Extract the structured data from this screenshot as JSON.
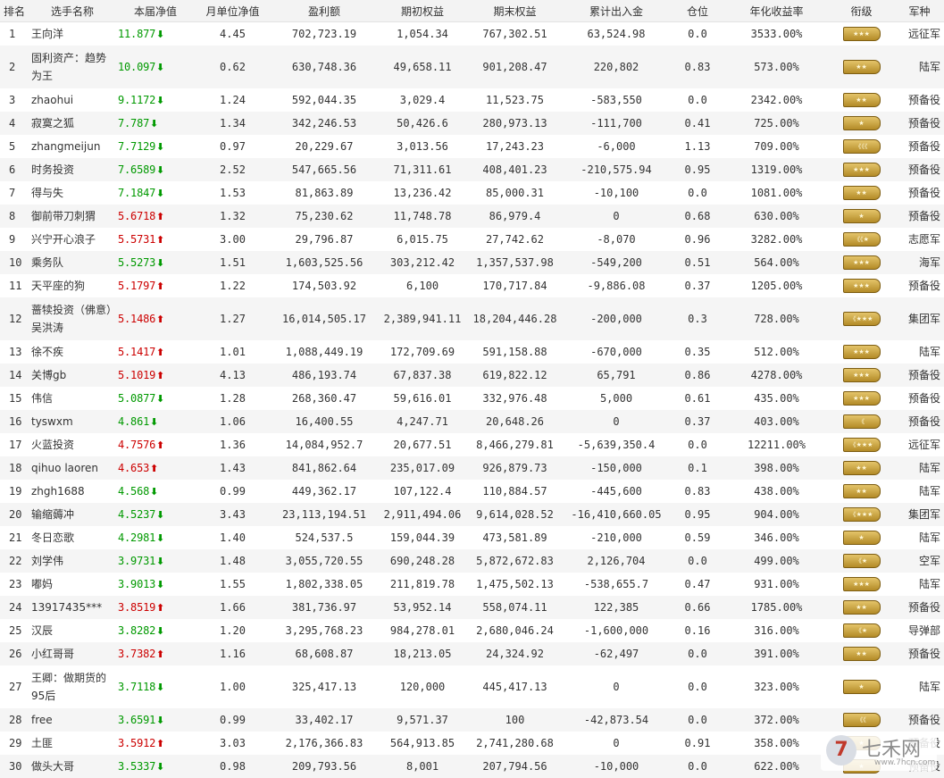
{
  "table": {
    "headers": [
      "排名",
      "选手名称",
      "本届净值",
      "月单位净值",
      "盈利额",
      "期初权益",
      "期末权益",
      "累计出入金",
      "仓位",
      "年化收益率",
      "衔级",
      "军种"
    ],
    "rows": [
      {
        "rank": "1",
        "name": "王向洋",
        "nav": "11.877",
        "trend": "down",
        "unit": "4.45",
        "profit": "702,723.19",
        "start": "1,054.34",
        "end": "767,302.51",
        "flow": "63,524.98",
        "position": "0.0",
        "annual": "3533.00%",
        "rank_badge": "★★★",
        "arm": "远征军"
      },
      {
        "rank": "2",
        "name": "固利资产：趋势为王",
        "nav": "10.097",
        "trend": "down",
        "unit": "0.62",
        "profit": "630,748.36",
        "start": "49,658.11",
        "end": "901,208.47",
        "flow": "220,802",
        "position": "0.83",
        "annual": "573.00%",
        "rank_badge": "★★",
        "arm": "陆军"
      },
      {
        "rank": "3",
        "name": "zhaohui",
        "nav": "9.1172",
        "trend": "down",
        "unit": "1.24",
        "profit": "592,044.35",
        "start": "3,029.4",
        "end": "11,523.75",
        "flow": "-583,550",
        "position": "0.0",
        "annual": "2342.00%",
        "rank_badge": "★★",
        "arm": "预备役"
      },
      {
        "rank": "4",
        "name": "寂寞之狐",
        "nav": "7.787",
        "trend": "down",
        "unit": "1.34",
        "profit": "342,246.53",
        "start": "50,426.6",
        "end": "280,973.13",
        "flow": "-111,700",
        "position": "0.41",
        "annual": "725.00%",
        "rank_badge": "★",
        "arm": "预备役"
      },
      {
        "rank": "5",
        "name": "zhangmeijun",
        "nav": "7.7129",
        "trend": "down",
        "unit": "0.97",
        "profit": "20,229.67",
        "start": "3,013.56",
        "end": "17,243.23",
        "flow": "-6,000",
        "position": "1.13",
        "annual": "709.00%",
        "rank_badge": "《《《",
        "arm": "预备役"
      },
      {
        "rank": "6",
        "name": "时务投资",
        "nav": "7.6589",
        "trend": "down",
        "unit": "2.52",
        "profit": "547,665.56",
        "start": "71,311.61",
        "end": "408,401.23",
        "flow": "-210,575.94",
        "position": "0.95",
        "annual": "1319.00%",
        "rank_badge": "★★★",
        "arm": "预备役"
      },
      {
        "rank": "7",
        "name": "得与失",
        "nav": "7.1847",
        "trend": "down",
        "unit": "1.53",
        "profit": "81,863.89",
        "start": "13,236.42",
        "end": "85,000.31",
        "flow": "-10,100",
        "position": "0.0",
        "annual": "1081.00%",
        "rank_badge": "★★",
        "arm": "预备役"
      },
      {
        "rank": "8",
        "name": "御前带刀刺猬",
        "nav": "5.6718",
        "trend": "up",
        "unit": "1.32",
        "profit": "75,230.62",
        "start": "11,748.78",
        "end": "86,979.4",
        "flow": "0",
        "position": "0.68",
        "annual": "630.00%",
        "rank_badge": "★",
        "arm": "预备役"
      },
      {
        "rank": "9",
        "name": "兴宁开心浪子",
        "nav": "5.5731",
        "trend": "up",
        "unit": "3.00",
        "profit": "29,796.87",
        "start": "6,015.75",
        "end": "27,742.62",
        "flow": "-8,070",
        "position": "0.96",
        "annual": "3282.00%",
        "rank_badge": "《《★",
        "arm": "志愿军"
      },
      {
        "rank": "10",
        "name": "乘务队",
        "nav": "5.5273",
        "trend": "down",
        "unit": "1.51",
        "profit": "1,603,525.56",
        "start": "303,212.42",
        "end": "1,357,537.98",
        "flow": "-549,200",
        "position": "0.51",
        "annual": "564.00%",
        "rank_badge": "★★★",
        "arm": "海军"
      },
      {
        "rank": "11",
        "name": "天平座的狗",
        "nav": "5.1797",
        "trend": "up",
        "unit": "1.22",
        "profit": "174,503.92",
        "start": "6,100",
        "end": "170,717.84",
        "flow": "-9,886.08",
        "position": "0.37",
        "annual": "1205.00%",
        "rank_badge": "★★★",
        "arm": "预备役"
      },
      {
        "rank": "12",
        "name": "蔷犊投资（佛意）吴洪涛",
        "nav": "5.1486",
        "trend": "up",
        "unit": "1.27",
        "profit": "16,014,505.17",
        "start": "2,389,941.11",
        "end": "18,204,446.28",
        "flow": "-200,000",
        "position": "0.3",
        "annual": "728.00%",
        "rank_badge": "《★★★",
        "arm": "集团军"
      },
      {
        "rank": "13",
        "name": "徐不疾",
        "nav": "5.1417",
        "trend": "up",
        "unit": "1.01",
        "profit": "1,088,449.19",
        "start": "172,709.69",
        "end": "591,158.88",
        "flow": "-670,000",
        "position": "0.35",
        "annual": "512.00%",
        "rank_badge": "★★★",
        "arm": "陆军"
      },
      {
        "rank": "14",
        "name": "关博gb",
        "nav": "5.1019",
        "trend": "up",
        "unit": "4.13",
        "profit": "486,193.74",
        "start": "67,837.38",
        "end": "619,822.12",
        "flow": "65,791",
        "position": "0.86",
        "annual": "4278.00%",
        "rank_badge": "★★★",
        "arm": "预备役"
      },
      {
        "rank": "15",
        "name": "伟信",
        "nav": "5.0877",
        "trend": "down",
        "unit": "1.28",
        "profit": "268,360.47",
        "start": "59,616.01",
        "end": "332,976.48",
        "flow": "5,000",
        "position": "0.61",
        "annual": "435.00%",
        "rank_badge": "★★★",
        "arm": "预备役"
      },
      {
        "rank": "16",
        "name": "tyswxm",
        "nav": "4.861",
        "trend": "down",
        "unit": "1.06",
        "profit": "16,400.55",
        "start": "4,247.71",
        "end": "20,648.26",
        "flow": "0",
        "position": "0.37",
        "annual": "403.00%",
        "rank_badge": "《",
        "arm": "预备役"
      },
      {
        "rank": "17",
        "name": "火蓝投资",
        "nav": "4.7576",
        "trend": "up",
        "unit": "1.36",
        "profit": "14,084,952.7",
        "start": "20,677.51",
        "end": "8,466,279.81",
        "flow": "-5,639,350.4",
        "position": "0.0",
        "annual": "12211.00%",
        "rank_badge": "《★★★",
        "arm": "远征军"
      },
      {
        "rank": "18",
        "name": "qihuo laoren",
        "nav": "4.653",
        "trend": "up",
        "unit": "1.43",
        "profit": "841,862.64",
        "start": "235,017.09",
        "end": "926,879.73",
        "flow": "-150,000",
        "position": "0.1",
        "annual": "398.00%",
        "rank_badge": "★★",
        "arm": "陆军"
      },
      {
        "rank": "19",
        "name": "zhgh1688",
        "nav": "4.568",
        "trend": "down",
        "unit": "0.99",
        "profit": "449,362.17",
        "start": "107,122.4",
        "end": "110,884.57",
        "flow": "-445,600",
        "position": "0.83",
        "annual": "438.00%",
        "rank_badge": "★★",
        "arm": "陆军"
      },
      {
        "rank": "20",
        "name": "输缩薅冲",
        "nav": "4.5237",
        "trend": "down",
        "unit": "3.43",
        "profit": "23,113,194.51",
        "start": "2,911,494.06",
        "end": "9,614,028.52",
        "flow": "-16,410,660.05",
        "position": "0.95",
        "annual": "904.00%",
        "rank_badge": "《★★★",
        "arm": "集团军"
      },
      {
        "rank": "21",
        "name": "冬日恋歌",
        "nav": "4.2981",
        "trend": "down",
        "unit": "1.40",
        "profit": "524,537.5",
        "start": "159,044.39",
        "end": "473,581.89",
        "flow": "-210,000",
        "position": "0.59",
        "annual": "346.00%",
        "rank_badge": "★",
        "arm": "陆军"
      },
      {
        "rank": "22",
        "name": "刘学伟",
        "nav": "3.9731",
        "trend": "down",
        "unit": "1.48",
        "profit": "3,055,720.55",
        "start": "690,248.28",
        "end": "5,872,672.83",
        "flow": "2,126,704",
        "position": "0.0",
        "annual": "499.00%",
        "rank_badge": "《★",
        "arm": "空军"
      },
      {
        "rank": "23",
        "name": "嘟妈",
        "nav": "3.9013",
        "trend": "down",
        "unit": "1.55",
        "profit": "1,802,338.05",
        "start": "211,819.78",
        "end": "1,475,502.13",
        "flow": "-538,655.7",
        "position": "0.47",
        "annual": "931.00%",
        "rank_badge": "★★★",
        "arm": "陆军"
      },
      {
        "rank": "24",
        "name": "13917435***",
        "nav": "3.8519",
        "trend": "up",
        "unit": "1.66",
        "profit": "381,736.97",
        "start": "53,952.14",
        "end": "558,074.11",
        "flow": "122,385",
        "position": "0.66",
        "annual": "1785.00%",
        "rank_badge": "★★",
        "arm": "预备役"
      },
      {
        "rank": "25",
        "name": "汉辰",
        "nav": "3.8282",
        "trend": "down",
        "unit": "1.20",
        "profit": "3,295,768.23",
        "start": "984,278.01",
        "end": "2,680,046.24",
        "flow": "-1,600,000",
        "position": "0.16",
        "annual": "316.00%",
        "rank_badge": "《★",
        "arm": "导弹部"
      },
      {
        "rank": "26",
        "name": "小红哥哥",
        "nav": "3.7382",
        "trend": "up",
        "unit": "1.16",
        "profit": "68,608.87",
        "start": "18,213.05",
        "end": "24,324.92",
        "flow": "-62,497",
        "position": "0.0",
        "annual": "391.00%",
        "rank_badge": "★★",
        "arm": "预备役"
      },
      {
        "rank": "27",
        "name": "王卿：做期货的95后",
        "nav": "3.7118",
        "trend": "down",
        "unit": "1.00",
        "profit": "325,417.13",
        "start": "120,000",
        "end": "445,417.13",
        "flow": "0",
        "position": "0.0",
        "annual": "323.00%",
        "rank_badge": "★",
        "arm": "陆军"
      },
      {
        "rank": "28",
        "name": "free",
        "nav": "3.6591",
        "trend": "down",
        "unit": "0.99",
        "profit": "33,402.17",
        "start": "9,571.37",
        "end": "100",
        "flow": "-42,873.54",
        "position": "0.0",
        "annual": "372.00%",
        "rank_badge": "《《",
        "arm": "预备役"
      },
      {
        "rank": "29",
        "name": "土匪",
        "nav": "3.5912",
        "trend": "up",
        "unit": "3.03",
        "profit": "2,176,366.83",
        "start": "564,913.85",
        "end": "2,741,280.68",
        "flow": "0",
        "position": "0.91",
        "annual": "358.00%",
        "rank_badge": "★",
        "arm": "预备役"
      },
      {
        "rank": "30",
        "name": "做头大哥",
        "nav": "3.5337",
        "trend": "down",
        "unit": "0.98",
        "profit": "209,793.56",
        "start": "8,001",
        "end": "207,794.56",
        "flow": "-10,000",
        "position": "0.0",
        "annual": "622.00%",
        "rank_badge": "★",
        "arm": "预备役"
      }
    ]
  },
  "watermark": {
    "logo": "7",
    "title": "七禾网",
    "url": "www.7hcn.com"
  },
  "colors": {
    "up": "#cc0000",
    "down": "#009900",
    "badge_gold": "#c9a23a",
    "header_bg": "#f3f3f3",
    "stripe": "#f5f5f5"
  }
}
